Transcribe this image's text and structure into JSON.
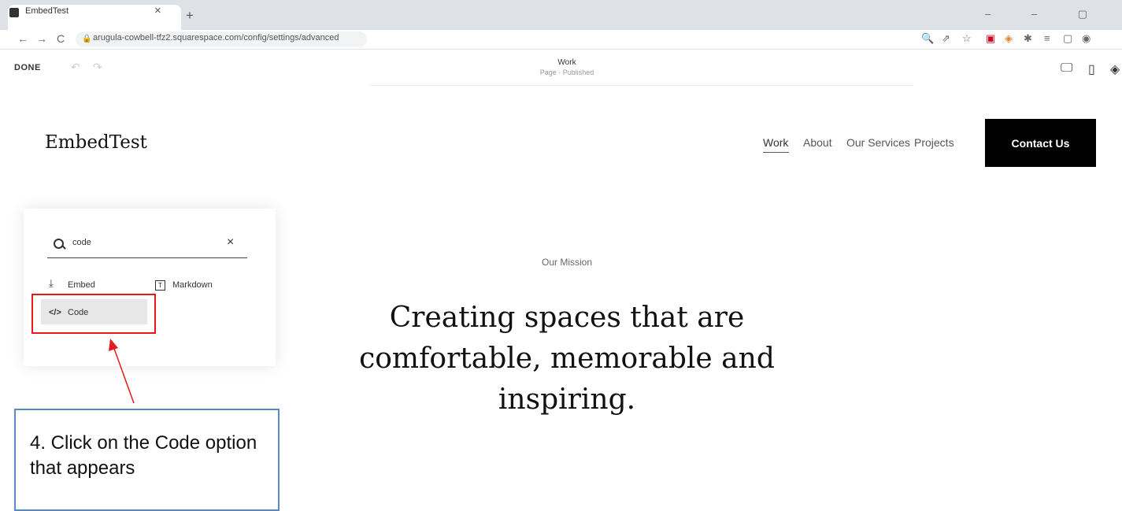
{
  "browser": {
    "tab_title": "EmbedTest",
    "tab_close": "×",
    "new_tab": "+",
    "window_controls": "‒ ‒ ▢",
    "url": "arugula-cowbell-tfz2.squarespace.com/config/settings/advanced",
    "nav": {
      "back": "←",
      "forward": "→",
      "reload": "C"
    },
    "extensions": [
      "🔍",
      "⇗",
      "☆",
      "▣",
      "◈",
      "✱",
      "≡",
      "▢",
      "◉"
    ]
  },
  "editor": {
    "done_label": "DONE",
    "undo": "↶",
    "redo": "↷",
    "page_name": "Work",
    "page_status": "Page · Published",
    "device_icons": {
      "desktop": "🖵",
      "mobile": "▯",
      "more": "◈"
    }
  },
  "site": {
    "title": "EmbedTest",
    "nav": [
      "Work",
      "About",
      "Our Services",
      "Projects"
    ],
    "active_nav": "Work",
    "cta": "Contact Us"
  },
  "block_picker": {
    "search_value": "code",
    "clear": "×",
    "options": [
      {
        "icon": "download-icon",
        "glyph": "⤓",
        "label": "Embed"
      },
      {
        "icon": "markdown-icon",
        "glyph": "T",
        "label": "Markdown"
      },
      {
        "icon": "code-icon",
        "glyph": "</>",
        "label": "Code"
      }
    ],
    "highlighted": "Code"
  },
  "content": {
    "eyebrow": "Our Mission",
    "heading": "Creating spaces that are comfortable, memorable and inspiring."
  },
  "annotation": {
    "text": "4. Click on the Code option that appears",
    "highlight_color": "#e31b1b",
    "callout_border_color": "#5b89c4"
  }
}
